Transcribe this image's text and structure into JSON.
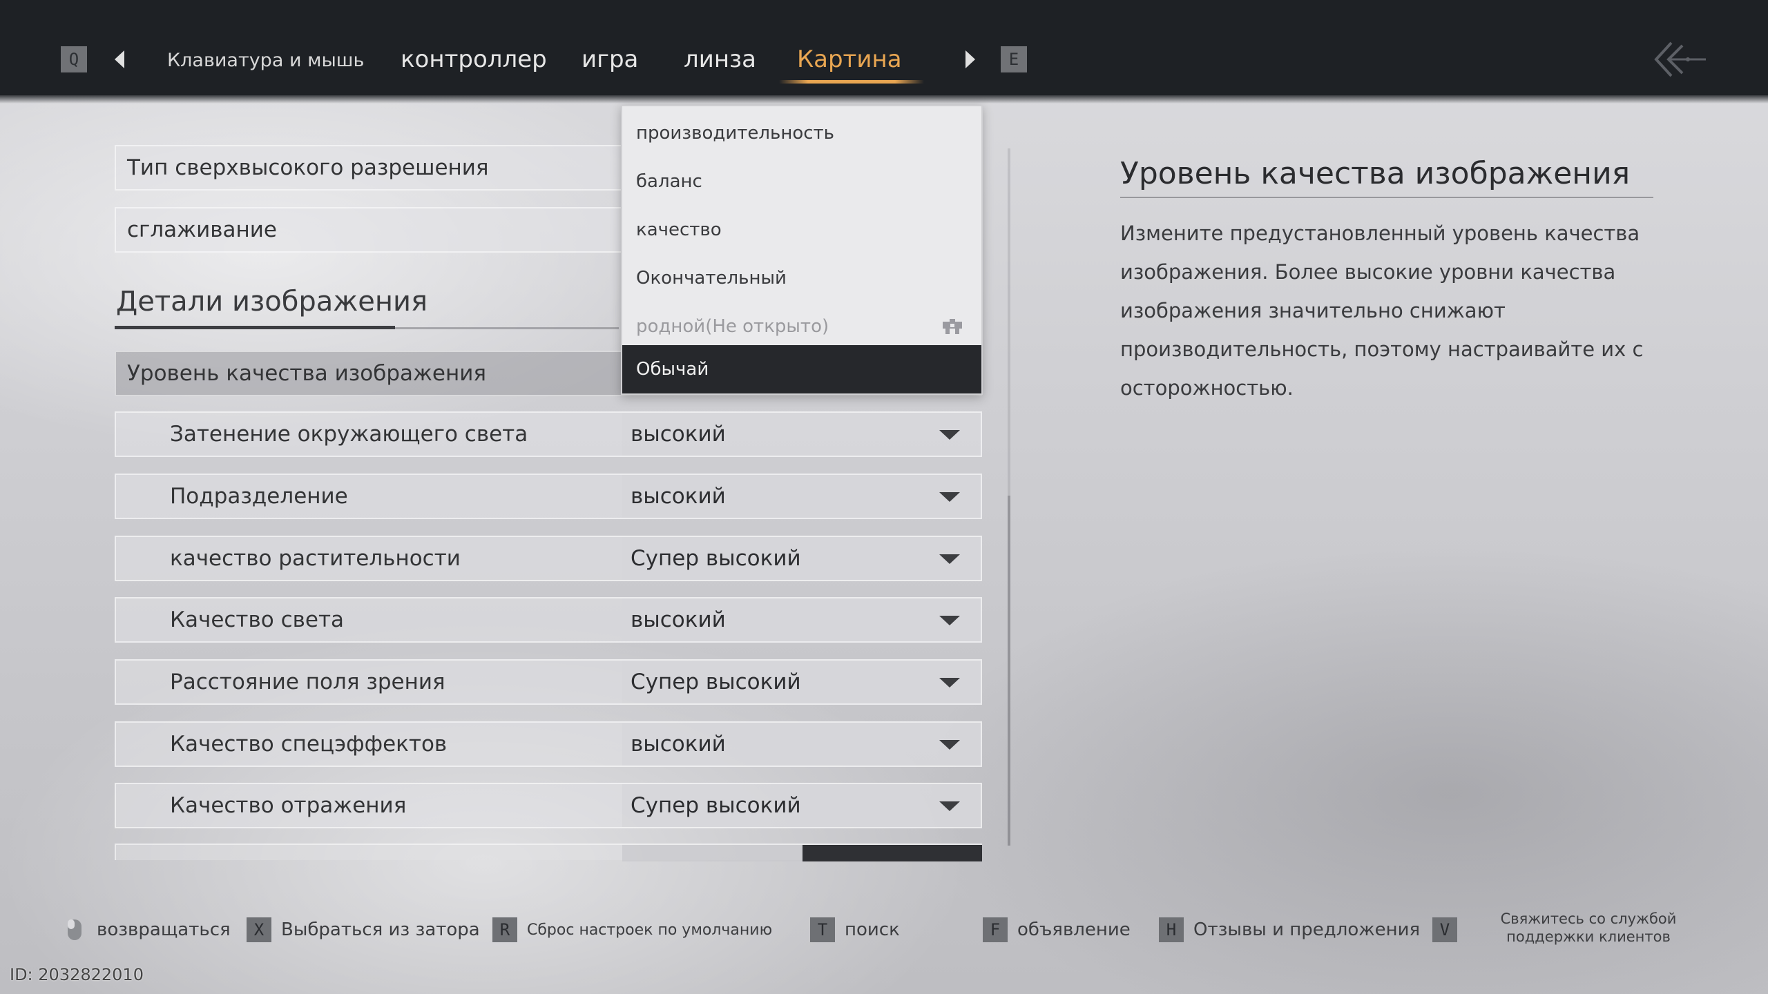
{
  "header": {
    "prev_key": "Q",
    "next_key": "E",
    "tabs": [
      {
        "label": "Клавиатура и мышь",
        "active": false
      },
      {
        "label": "контроллер",
        "active": false
      },
      {
        "label": "игра",
        "active": false
      },
      {
        "label": "линза",
        "active": false
      },
      {
        "label": "Картина",
        "active": true
      }
    ],
    "accent_color": "#e9a652"
  },
  "settings": {
    "top_rows": [
      {
        "label": "Тип сверхвысокого разрешения"
      },
      {
        "label": "сглаживание"
      }
    ],
    "section_title": "Детали изображения",
    "quality_row": {
      "label": "Уровень качества изображения"
    },
    "sub_rows": [
      {
        "label": "Затенение окружающего света",
        "value": "высокий"
      },
      {
        "label": "Подразделение",
        "value": "высокий"
      },
      {
        "label": "качество растительности",
        "value": "Супер высокий"
      },
      {
        "label": "Качество света",
        "value": "высокий"
      },
      {
        "label": "Расстояние поля зрения",
        "value": "Супер высокий"
      },
      {
        "label": "Качество спецэффектов",
        "value": "высокий"
      },
      {
        "label": "Качество отражения",
        "value": "Супер высокий"
      }
    ]
  },
  "dropdown": {
    "options": [
      {
        "label": "производительность",
        "state": "normal"
      },
      {
        "label": "баланс",
        "state": "normal"
      },
      {
        "label": "качество",
        "state": "normal"
      },
      {
        "label": "Окончательный",
        "state": "normal"
      },
      {
        "label": "родной(Не открыто)",
        "state": "locked"
      },
      {
        "label": "Обычай",
        "state": "selected"
      }
    ]
  },
  "description": {
    "title": "Уровень качества изображения",
    "text": "Измените предустановленный уровень качества изображения. Более высокие уровни качества изображения значительно снижают производительность, поэтому настраивайте их с осторожностью."
  },
  "footer": {
    "hints": [
      {
        "key": "",
        "icon": "mouse-icon",
        "label": "возвращаться"
      },
      {
        "key": "X",
        "label": "Выбраться из затора"
      },
      {
        "key": "R",
        "label": "Сброс настроек по умолчанию"
      },
      {
        "key": "T",
        "label": "поиск"
      },
      {
        "key": "F",
        "label": "объявление"
      },
      {
        "key": "H",
        "label": "Отзывы и предложения"
      },
      {
        "key": "V",
        "label": ""
      }
    ],
    "support_label": "Свяжитесь со службой поддержки клиентов",
    "uid": "ID: 2032822010"
  }
}
